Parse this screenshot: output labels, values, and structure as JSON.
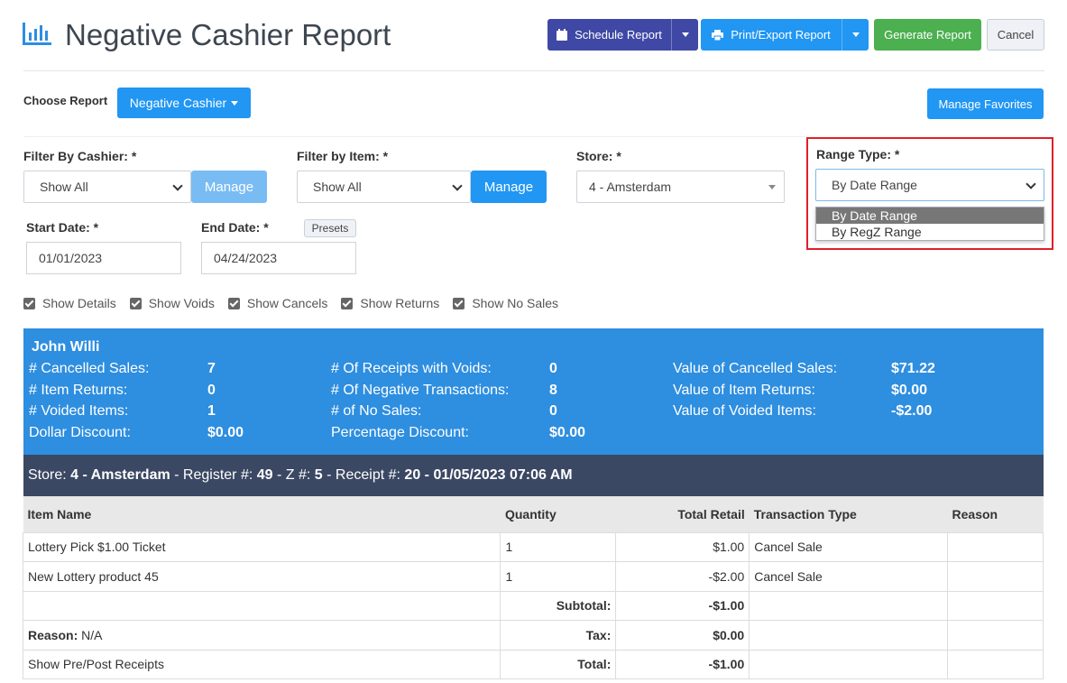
{
  "header": {
    "title": "Negative Cashier Report",
    "schedule_label": "Schedule Report",
    "print_label": "Print/Export Report",
    "generate_label": "Generate Report",
    "cancel_label": "Cancel"
  },
  "choose_report": {
    "label": "Choose Report",
    "value": "Negative Cashier",
    "manage_favorites": "Manage Favorites"
  },
  "filters": {
    "cashier_label": "Filter By Cashier: *",
    "cashier_value": "Show All",
    "cashier_manage": "Manage",
    "item_label": "Filter by Item: *",
    "item_value": "Show All",
    "item_manage": "Manage",
    "store_label": "Store: *",
    "store_value": "4 - Amsterdam",
    "range_label": "Range Type: *",
    "range_value": "By Date Range",
    "range_options": [
      "By Date Range",
      "By RegZ Range"
    ],
    "start_label": "Start Date: *",
    "start_value": "01/01/2023",
    "end_label": "End Date: *",
    "end_value": "04/24/2023",
    "presets": "Presets"
  },
  "checkboxes": [
    "Show Details",
    "Show Voids",
    "Show Cancels",
    "Show Returns",
    "Show No Sales"
  ],
  "summary": {
    "name": "John Willi",
    "col1": [
      {
        "label": "# Cancelled Sales:",
        "value": "7"
      },
      {
        "label": "# Item Returns:",
        "value": "0"
      },
      {
        "label": "# Voided Items:",
        "value": "1"
      },
      {
        "label": "Dollar Discount:",
        "value": "$0.00"
      }
    ],
    "col2": [
      {
        "label": "# Of Receipts with Voids:",
        "value": "0"
      },
      {
        "label": "# Of Negative Transactions:",
        "value": "8"
      },
      {
        "label": "# of No Sales:",
        "value": "0"
      },
      {
        "label": "Percentage Discount:",
        "value": "$0.00"
      }
    ],
    "col3": [
      {
        "label": "Value of Cancelled Sales:",
        "value": "$71.22"
      },
      {
        "label": "Value of Item Returns:",
        "value": "$0.00"
      },
      {
        "label": "Value of Voided Items:",
        "value": "-$2.00"
      }
    ]
  },
  "receipt": {
    "store_label": "Store:",
    "store": "4 - Amsterdam",
    "register_label": "- Register #:",
    "register": "49",
    "z_label": "- Z #:",
    "z": "5",
    "receipt_label": "- Receipt #:",
    "receipt": "20 - 01/05/2023 07:06 AM"
  },
  "table": {
    "headers": [
      "Item Name",
      "Quantity",
      "Total Retail",
      "Transaction Type",
      "Reason"
    ],
    "rows": [
      {
        "name": "Lottery Pick $1.00 Ticket",
        "qty": "1",
        "total": "$1.00",
        "type": "Cancel Sale",
        "reason": ""
      },
      {
        "name": "New Lottery product 45",
        "qty": "1",
        "total": "-$2.00",
        "type": "Cancel Sale",
        "reason": ""
      }
    ],
    "subtotal_label": "Subtotal:",
    "subtotal": "-$1.00",
    "reason_label": "Reason:",
    "reason_value": "N/A",
    "tax_label": "Tax:",
    "tax": "$0.00",
    "pre_post_link": "Show Pre/Post Receipts",
    "total_label": "Total:",
    "total": "-$1.00"
  },
  "colors": {
    "summary_bg": "#2e8ee0",
    "store_bar_bg": "#3b4863",
    "cancel_red": "#d9302b",
    "highlight_border": "#e0202b"
  }
}
